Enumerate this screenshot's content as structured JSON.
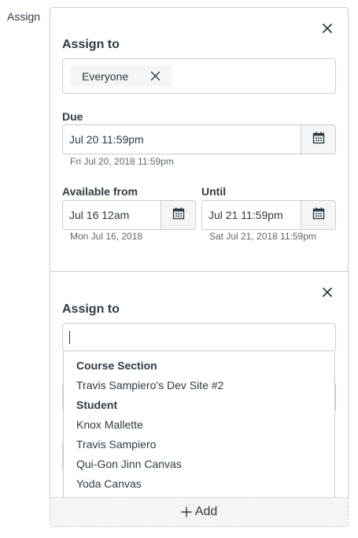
{
  "page": {
    "assign_label": "Assign"
  },
  "card1": {
    "assign_to_label": "Assign to",
    "assignee_token": "Everyone",
    "due_label": "Due",
    "due_value": "Jul 20 11:59pm",
    "due_hint": "Fri Jul 20, 2018 11:59pm",
    "available_from_label": "Available from",
    "available_from_value": "Jul 16 12am",
    "available_from_hint": "Mon Jul 16, 2018",
    "until_label": "Until",
    "until_value": "Jul 21 11:59pm",
    "until_hint": "Sat Jul 21, 2018 11:59pm"
  },
  "card2": {
    "assign_to_label": "Assign to",
    "search_value": "",
    "dropdown": {
      "groups": [
        {
          "label": "Course Section",
          "items": [
            "Travis Sampiero's Dev Site #2"
          ]
        },
        {
          "label": "Student",
          "items": [
            "Knox Mallette",
            "Travis Sampiero",
            "Qui-Gon Jinn Canvas",
            "Yoda Canvas"
          ]
        }
      ]
    }
  },
  "footer": {
    "add_label": "Add"
  },
  "icons": {
    "close": "close-icon",
    "remove": "remove-token-icon",
    "calendar": "calendar-icon",
    "add": "plus-icon"
  },
  "colors": {
    "border": "#c7cdd1",
    "text": "#2d3b45",
    "hint": "#5b6770",
    "button_bg": "#f5f5f5"
  }
}
